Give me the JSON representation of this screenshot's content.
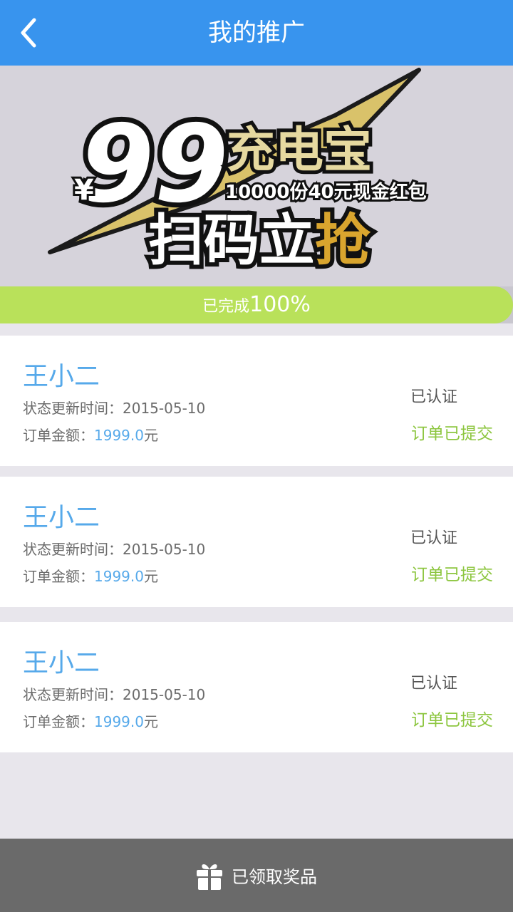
{
  "header": {
    "title": "我的推广",
    "back_icon": "chevron-left-icon"
  },
  "banner": {
    "currency": "¥",
    "price": "99",
    "product": "充电宝",
    "subtitle": "10000份40元现金红包",
    "slogan_main": "扫码立",
    "slogan_highlight": "抢",
    "colors": {
      "gold": "#d9c26a",
      "dark": "#111111",
      "bg": "#d6d3db"
    }
  },
  "progress": {
    "label": "已完成",
    "percent_text": "100%",
    "value": 1.0,
    "fill_color": "#b9e15a"
  },
  "list": [
    {
      "name": "王小二",
      "status_time_label": "状态更新时间：",
      "status_time": "2015-05-10",
      "amount_label": "订单金额：",
      "amount": "1999.0",
      "amount_unit": "元",
      "auth": "已认证",
      "order_status": "订单已提交"
    },
    {
      "name": "王小二",
      "status_time_label": "状态更新时间：",
      "status_time": "2015-05-10",
      "amount_label": "订单金额：",
      "amount": "1999.0",
      "amount_unit": "元",
      "auth": "已认证",
      "order_status": "订单已提交"
    },
    {
      "name": "王小二",
      "status_time_label": "状态更新时间：",
      "status_time": "2015-05-10",
      "amount_label": "订单金额：",
      "amount": "1999.0",
      "amount_unit": "元",
      "auth": "已认证",
      "order_status": "订单已提交"
    }
  ],
  "footer": {
    "icon": "gift-icon",
    "label": "已领取奖品"
  },
  "theme": {
    "primary": "#3894ee",
    "name_blue": "#56a9ea",
    "green": "#8dc640",
    "footer_bg": "#6a6a6a"
  }
}
